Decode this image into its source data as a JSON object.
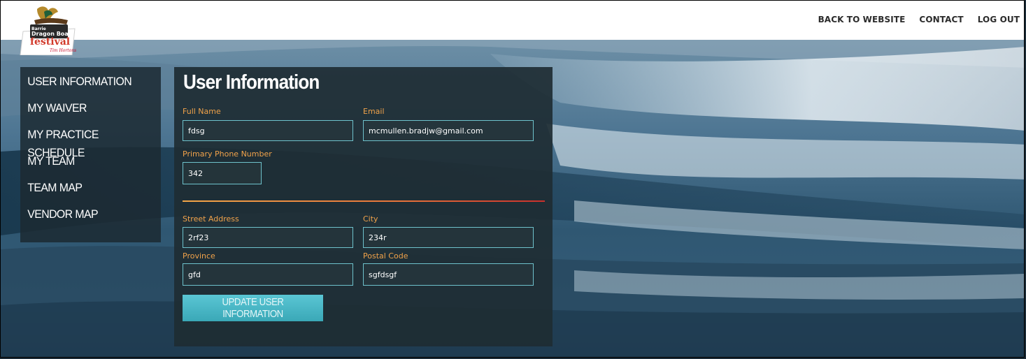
{
  "brand": {
    "logo_text": "Barrie Dragon Boat Festival",
    "sponsor": "Tim Hortons"
  },
  "topnav": {
    "back": "BACK TO WEBSITE",
    "contact": "CONTACT",
    "logout": "LOG OUT"
  },
  "sidebar": {
    "items": [
      {
        "label": "USER INFORMATION"
      },
      {
        "label": "MY WAIVER"
      },
      {
        "label": "MY PRACTICE SCHEDULE"
      },
      {
        "label": "MY TEAM"
      },
      {
        "label": "TEAM MAP"
      },
      {
        "label": "VENDOR MAP"
      }
    ]
  },
  "form": {
    "title": "User Information",
    "full_name": {
      "label": "Full Name",
      "value": "fdsg"
    },
    "email": {
      "label": "Email",
      "value": "mcmullen.bradjw@gmail.com"
    },
    "phone": {
      "label": "Primary Phone Number",
      "value": "342"
    },
    "street": {
      "label": "Street Address",
      "value": "2rf23"
    },
    "city": {
      "label": "City",
      "value": "234r"
    },
    "province": {
      "label": "Province",
      "value": "gfd"
    },
    "postal": {
      "label": "Postal Code",
      "value": "sgfdsgf"
    },
    "submit_label": "UPDATE USER INFORMATION"
  },
  "colors": {
    "accent": "#f0a24a",
    "field_border": "#6ec2cc",
    "button": "#47b6c4"
  }
}
